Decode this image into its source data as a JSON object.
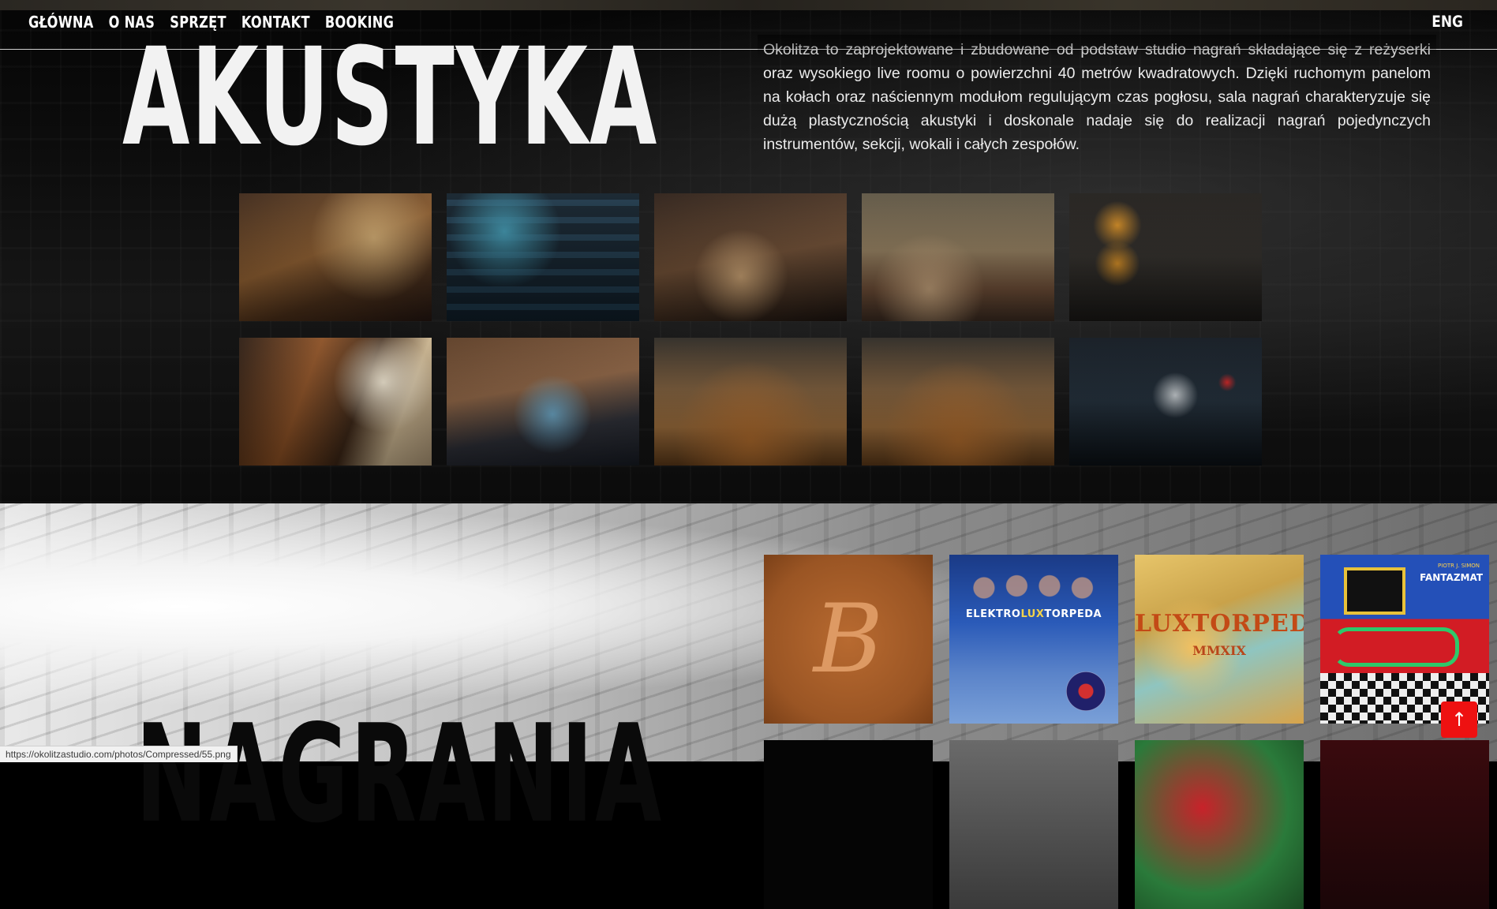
{
  "nav": {
    "items": [
      {
        "label": "GŁÓWNA"
      },
      {
        "label": "O NAS"
      },
      {
        "label": "SPRZĘT"
      },
      {
        "label": "KONTAKT"
      },
      {
        "label": "BOOKING"
      }
    ],
    "lang_label": "ENG"
  },
  "acoustics": {
    "title": "AKUSTYKA",
    "description": "Okolitza to zaprojektowane i zbudowane od podstaw studio nagrań składające się z reżyserki oraz wysokiego live roomu o powierzchni 40 metrów kwadratowych. Dzięki ruchomym panelom na kołach oraz naściennym modułom regulującym czas pogłosu, sala nagrań charakteryzuje się dużą plastycznością akustyki i doskonale nadaje się do realizacji nagrań pojedynczych instrumentów, sekcji, wokali i całych zespołów."
  },
  "recordings": {
    "title": "NAGRANIA",
    "covers": [
      {
        "text": "B"
      },
      {
        "text_part1": "ELEKTRO",
        "text_part2": "LUX",
        "text_part3": "TORPEDA"
      },
      {
        "title": "LUXTORPEDA",
        "subtitle": "MMXIX"
      },
      {
        "small": "PIOTR J. SIMON",
        "title": "FANTAZMAT"
      }
    ]
  },
  "status_url": "https://okolitzastudio.com/photos/Compressed/55.png",
  "back_to_top": {
    "icon": "arrow-up-icon",
    "glyph": "↑",
    "color": "#ee1111"
  }
}
